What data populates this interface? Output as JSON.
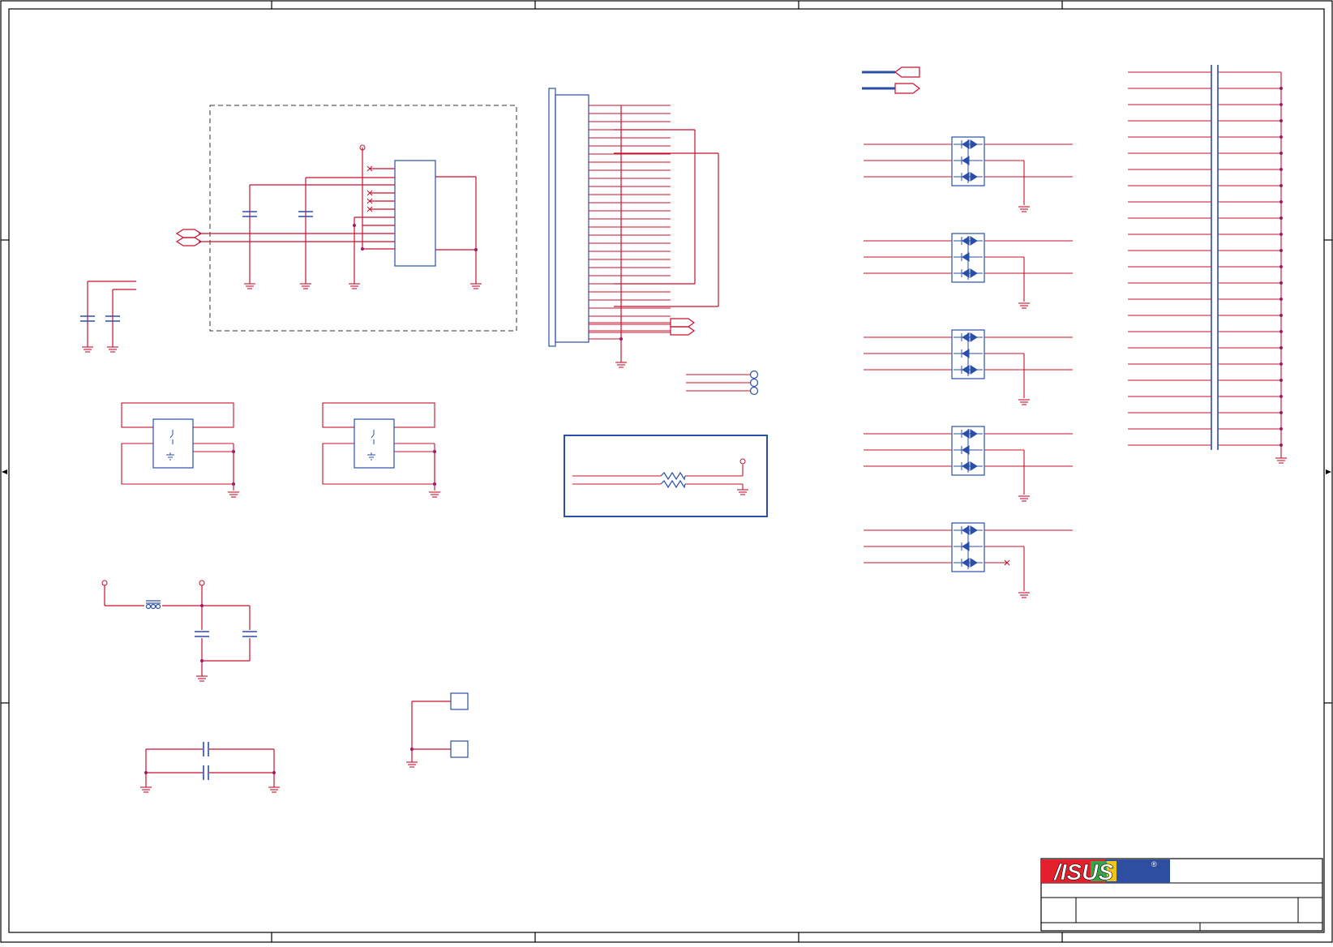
{
  "colors": {
    "wire": "#c8102e",
    "part": "#2a4fa8",
    "frame": "#000000",
    "dash": "#333333",
    "logo_red": "#e4202c",
    "logo_blue": "#2e4ea1"
  },
  "title_block": {
    "logo": "/ISUS",
    "registered": "®"
  },
  "icons": [
    "ground-icon",
    "capacitor-icon",
    "tvs-diode-array-icon",
    "resistor-icon",
    "power-flag-icon",
    "offpage-connector-icon",
    "switch-icon"
  ]
}
